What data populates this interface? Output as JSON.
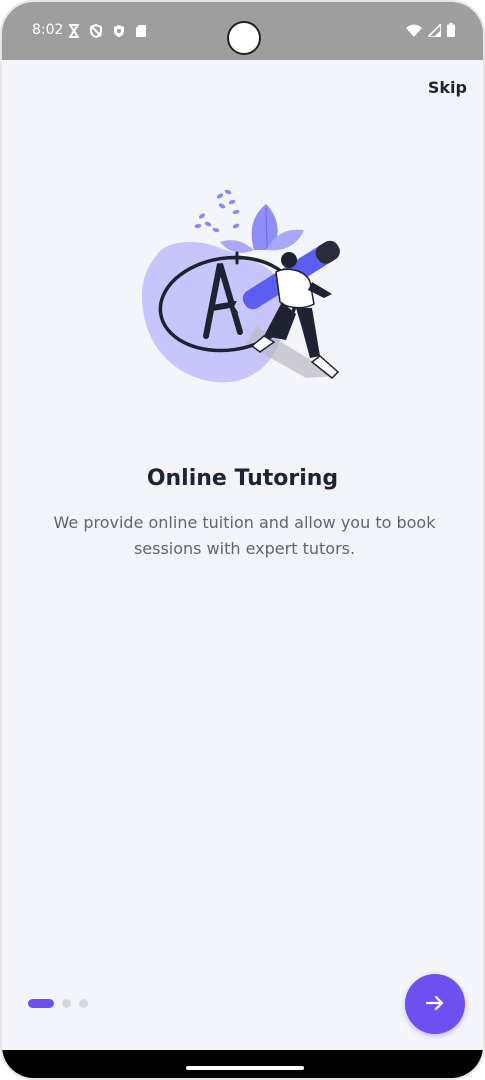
{
  "status_bar": {
    "time": "8:02",
    "left_icons": [
      "hourglass-icon",
      "shield-off-icon",
      "shield-icon",
      "sd-card-icon"
    ],
    "right_icons": [
      "wifi-icon",
      "signal-icon",
      "battery-icon"
    ]
  },
  "onboarding": {
    "skip_label": "Skip",
    "title": "Online Tutoring",
    "description": "We provide online tuition and allow you to book sessions with expert tutors.",
    "illustration_icon": "tutor-writing-a-plus-illustration",
    "page_count": 3,
    "current_page": 1,
    "next_icon": "arrow-right-icon"
  },
  "colors": {
    "accent": "#6e4ff0",
    "background": "#f4f5fa",
    "title": "#1d2433",
    "body_text": "#5f6573",
    "status_bar": "#9e9e9e",
    "illustration_blob": "#c7c5fb"
  }
}
